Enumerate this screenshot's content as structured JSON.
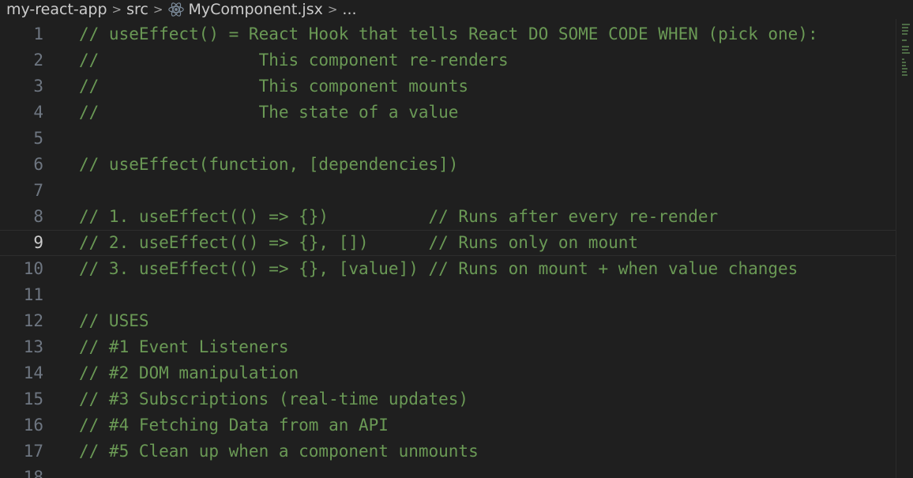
{
  "breadcrumb": {
    "items": [
      "my-react-app",
      "src",
      "MyComponent.jsx",
      "..."
    ],
    "separator": ">"
  },
  "editor": {
    "active_line": 9,
    "lines": [
      {
        "n": "1",
        "text": "// useEffect() = React Hook that tells React DO SOME CODE WHEN (pick one):"
      },
      {
        "n": "2",
        "text": "//                This component re-renders"
      },
      {
        "n": "3",
        "text": "//                This component mounts"
      },
      {
        "n": "4",
        "text": "//                The state of a value"
      },
      {
        "n": "5",
        "text": ""
      },
      {
        "n": "6",
        "text": "// useEffect(function, [dependencies])"
      },
      {
        "n": "7",
        "text": ""
      },
      {
        "n": "8",
        "text": "// 1. useEffect(() => {})          // Runs after every re-render"
      },
      {
        "n": "9",
        "text": "// 2. useEffect(() => {}, [])      // Runs only on mount"
      },
      {
        "n": "10",
        "text": "// 3. useEffect(() => {}, [value]) // Runs on mount + when value changes"
      },
      {
        "n": "11",
        "text": ""
      },
      {
        "n": "12",
        "text": "// USES"
      },
      {
        "n": "13",
        "text": "// #1 Event Listeners"
      },
      {
        "n": "14",
        "text": "// #2 DOM manipulation"
      },
      {
        "n": "15",
        "text": "// #3 Subscriptions (real-time updates)"
      },
      {
        "n": "16",
        "text": "// #4 Fetching Data from an API"
      },
      {
        "n": "17",
        "text": "// #5 Clean up when a component unmounts"
      },
      {
        "n": "18",
        "text": ""
      }
    ]
  },
  "colors": {
    "background": "#1f1f1f",
    "comment": "#6a9955",
    "line_number": "#6e7681",
    "active_line_number": "#cccccc",
    "react_icon": "#61dafb"
  },
  "icons": {
    "file_icon": "react-icon"
  }
}
